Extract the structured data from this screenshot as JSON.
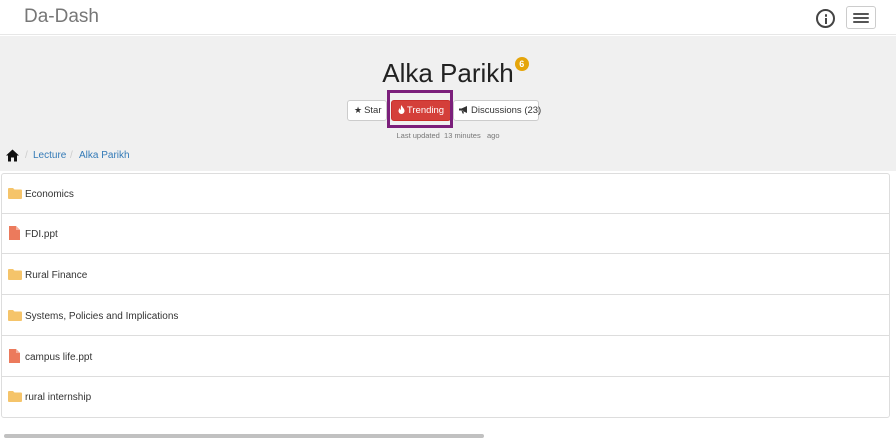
{
  "app": {
    "brand": "Da-Dash"
  },
  "header": {
    "title": "Alka Parikh",
    "badge": "6",
    "buttons": {
      "star": "Star",
      "trending": "Trending",
      "discussions": "Discussions (23)"
    },
    "last_updated": {
      "label": "Last updated",
      "value": "13 minutes",
      "suffix": "ago"
    }
  },
  "breadcrumb": {
    "items": [
      "Lecture",
      "Alka Parikh"
    ]
  },
  "files": [
    {
      "name": "Economics",
      "type": "folder"
    },
    {
      "name": "FDI.ppt",
      "type": "file"
    },
    {
      "name": "Rural Finance",
      "type": "folder"
    },
    {
      "name": "Systems, Policies and Implications",
      "type": "folder"
    },
    {
      "name": "campus life.ppt",
      "type": "file"
    },
    {
      "name": "rural internship",
      "type": "folder"
    }
  ],
  "icons": {
    "info": "info-icon",
    "menu": "hamburger-icon",
    "star": "star-icon",
    "trending": "fire-icon",
    "discussions": "megaphone-icon",
    "home": "home-icon",
    "folder": "folder-icon",
    "file": "file-icon"
  },
  "colors": {
    "folder": "#f5c46a",
    "file": "#ec7a5c",
    "trending": "#d43f3a",
    "badge": "#e5a50a",
    "link": "#337ab7",
    "highlight": "#7b1f7b"
  }
}
